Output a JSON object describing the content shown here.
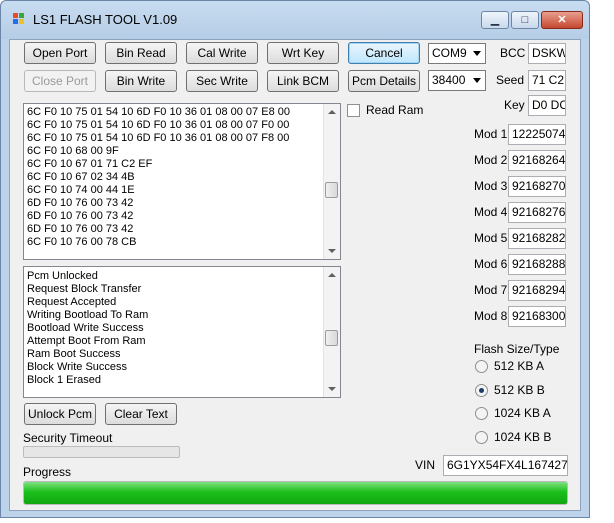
{
  "window": {
    "title": "LS1 FLASH TOOL V1.09",
    "minimize": "▁",
    "maximize": "□",
    "close": "✕"
  },
  "buttons": {
    "open_port": "Open Port",
    "bin_read": "Bin Read",
    "cal_write": "Cal Write",
    "wrt_key": "Wrt Key",
    "cancel": "Cancel",
    "close_port": "Close Port",
    "bin_write": "Bin Write",
    "sec_write": "Sec Write",
    "link_bcm": "Link BCM",
    "pcm_details": "Pcm Details",
    "unlock_pcm": "Unlock Pcm",
    "clear_text": "Clear Text"
  },
  "port": {
    "com": "COM9",
    "baud": "38400"
  },
  "keys": {
    "bcc_label": "BCC",
    "bcc": "DSKW",
    "seed_label": "Seed",
    "seed": "71 C2",
    "key_label": "Key",
    "key": "D0 DC"
  },
  "read_ram": "Read Ram",
  "mods": [
    {
      "label": "Mod 1",
      "value": "12225074"
    },
    {
      "label": "Mod 2",
      "value": "92168264"
    },
    {
      "label": "Mod 3",
      "value": "92168270"
    },
    {
      "label": "Mod 4",
      "value": "92168276"
    },
    {
      "label": "Mod 5",
      "value": "92168282"
    },
    {
      "label": "Mod 6",
      "value": "92168288"
    },
    {
      "label": "Mod 7",
      "value": "92168294"
    },
    {
      "label": "Mod 8",
      "value": "92168300"
    }
  ],
  "hex_log": [
    "6C F0 10 75 01 54 10 6D F0 10 36 01 08 00 07 E8 00",
    "6C F0 10 75 01 54 10 6D F0 10 36 01 08 00 07 F0 00",
    "6C F0 10 75 01 54 10 6D F0 10 36 01 08 00 07 F8 00",
    "6C F0 10 68 00 9F",
    "6C F0 10 67 01 71 C2 EF",
    "6C F0 10 67 02 34 4B",
    "6C F0 10 74 00 44 1E",
    "6D F0 10 76 00 73 42",
    "6D F0 10 76 00 73 42",
    "6D F0 10 76 00 73 42",
    "6C F0 10 76 00 78 CB"
  ],
  "status_log": [
    "Pcm Unlocked",
    "Request Block Transfer",
    "Request Accepted",
    "Writing Bootload To Ram",
    "Bootload Write Success",
    "Attempt Boot From Ram",
    "Ram Boot Success",
    "Block Write Success",
    "Block 1 Erased"
  ],
  "flash": {
    "label": "Flash Size/Type",
    "options": [
      "512 KB A",
      "512 KB B",
      "1024 KB A",
      "1024 KB B"
    ],
    "selected_index": 1
  },
  "security_timeout_label": "Security Timeout",
  "security_timeout_progress": 0,
  "progress_label": "Progress",
  "progress": 100,
  "vin_label": "VIN",
  "vin": "6G1YX54FX4L167427",
  "colors": {
    "progress_fill": "#1cbf1c",
    "focus_border": "#3c7fb1"
  }
}
